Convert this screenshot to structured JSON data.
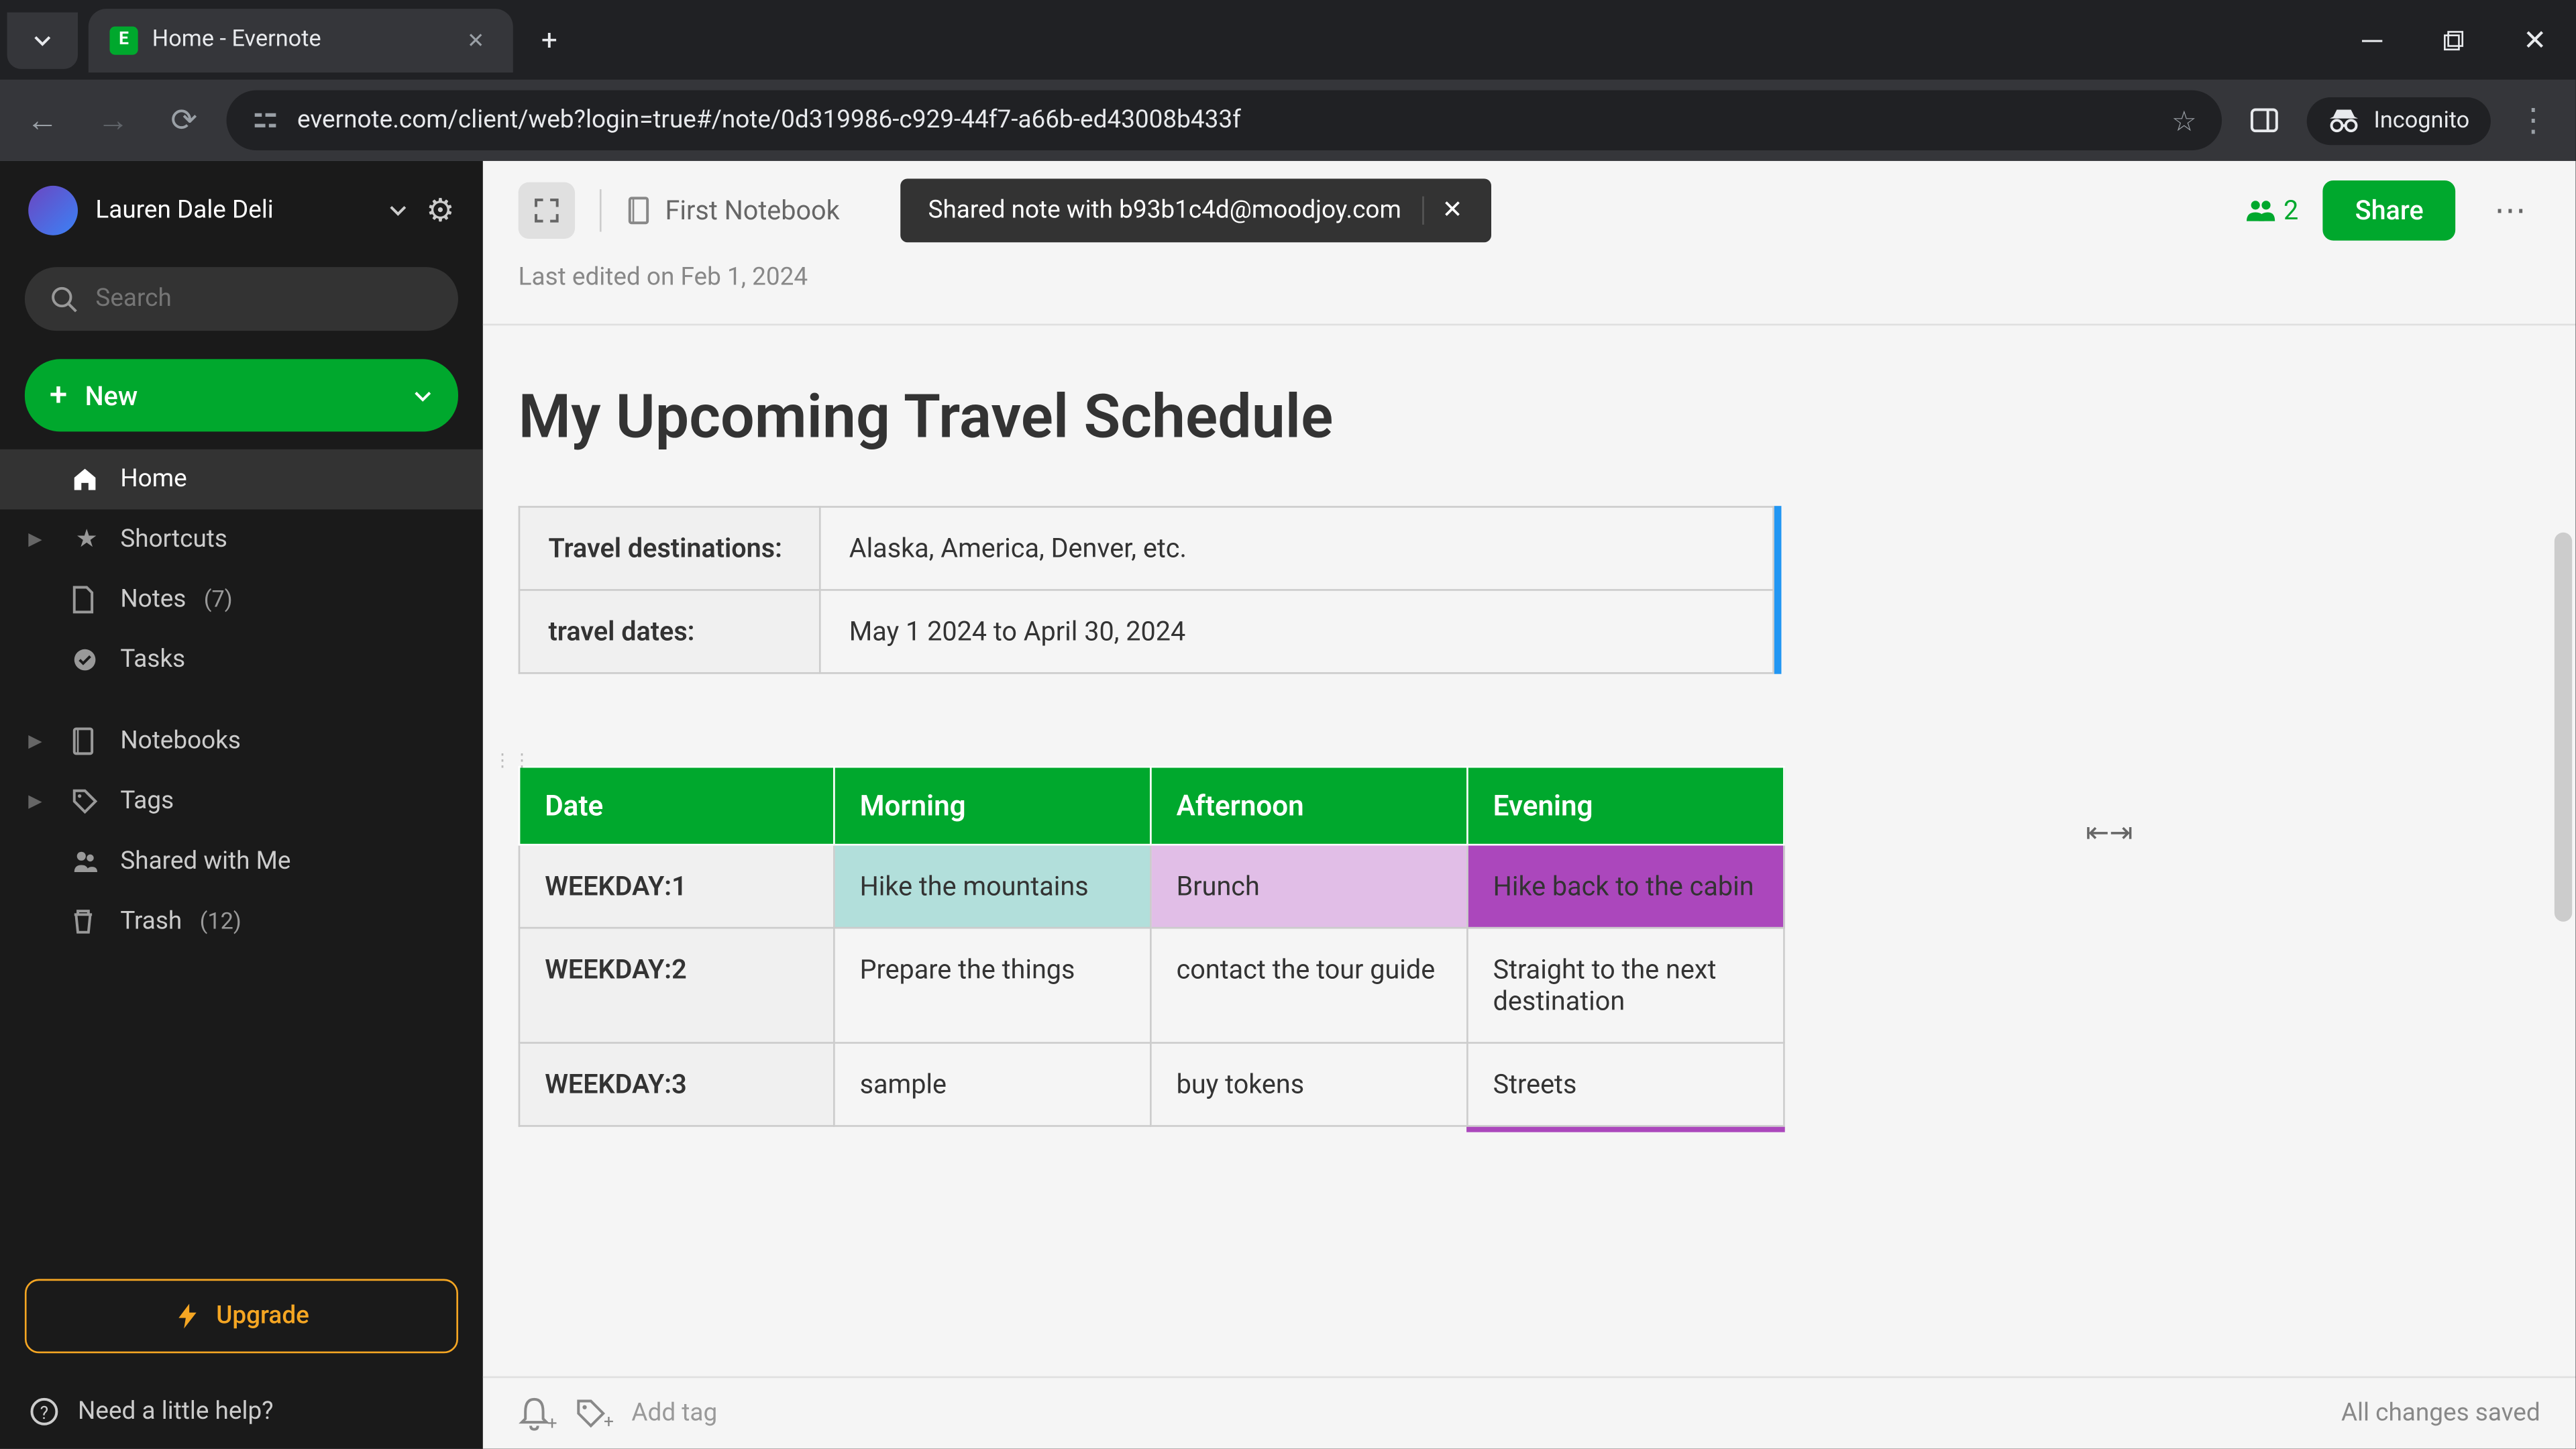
{
  "browser": {
    "tab_title": "Home - Evernote",
    "url": "evernote.com/client/web?login=true#/note/0d319986-c929-44f7-a66b-ed43008b433f",
    "incognito_label": "Incognito"
  },
  "sidebar": {
    "user_name": "Lauren Dale Deli",
    "search_placeholder": "Search",
    "new_label": "New",
    "items": {
      "home": "Home",
      "shortcuts": "Shortcuts",
      "notes": "Notes",
      "notes_count": "(7)",
      "tasks": "Tasks",
      "notebooks": "Notebooks",
      "tags": "Tags",
      "shared": "Shared with Me",
      "trash": "Trash",
      "trash_count": "(12)"
    },
    "upgrade_label": "Upgrade",
    "help_label": "Need a little help?"
  },
  "header": {
    "notebook_name": "First Notebook",
    "share_notification": "Shared note with b93b1c4d@moodjoy.com",
    "people_count": "2",
    "share_button": "Share",
    "last_edited": "Last edited on Feb 1, 2024"
  },
  "note": {
    "title": "My Upcoming Travel Schedule",
    "info_table": [
      {
        "label": "Travel destinations:",
        "value": "Alaska, America, Denver, etc."
      },
      {
        "label": "travel dates:",
        "value": "May 1 2024 to April 30, 2024"
      }
    ],
    "schedule": {
      "columns": [
        "Date",
        "Morning",
        "Afternoon",
        "Evening"
      ],
      "rows": [
        {
          "label": "WEEKDAY:1",
          "morning": "Hike the mountains",
          "afternoon": "Brunch",
          "evening": "Hike back to the cabin"
        },
        {
          "label": "WEEKDAY:2",
          "morning": "Prepare the things",
          "afternoon": "contact the tour guide",
          "evening": "Straight to the next destination"
        },
        {
          "label": "WEEKDAY:3",
          "morning": "sample",
          "afternoon": "buy tokens",
          "evening": "Streets"
        }
      ]
    }
  },
  "footer": {
    "add_tag_placeholder": "Add tag",
    "save_status": "All changes saved"
  }
}
